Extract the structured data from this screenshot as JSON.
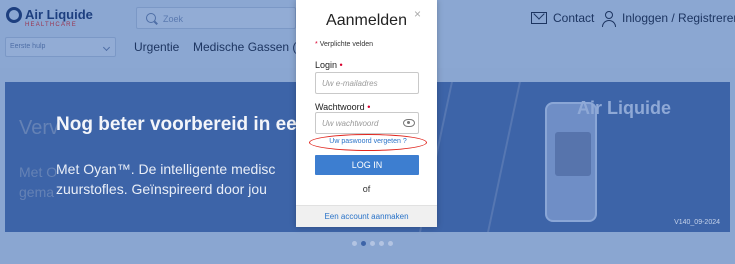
{
  "header": {
    "logo": {
      "name": "Air Liquide",
      "sub": "HEALTHCARE"
    },
    "search": {
      "placeholder": "Zoek"
    },
    "help_select": {
      "value": "Eerste hulp"
    },
    "nav": [
      "Urgentie",
      "Medische Gassen (ge"
    ],
    "contact_label": "Contact",
    "login_label": "Inloggen / Registreren"
  },
  "hero": {
    "ghost_title": "Verv",
    "ghost_text_1": "Met O",
    "ghost_text_2": "gema",
    "title": "Nog beter voorbereid in een",
    "text_line_1": "Met Oyan™. De intelligente medisc",
    "text_line_2": "zuurstofles. Geïnspireerd door jou",
    "brand": "Air Liquide",
    "version": "V140_09-2024"
  },
  "carousel": {
    "count": 5,
    "active": 2
  },
  "modal": {
    "title": "Aanmelden",
    "close_glyph": "×",
    "required_star": "*",
    "required_note": "Verplichte velden",
    "login_label": "Login",
    "login_placeholder": "Uw e-mailadres",
    "password_label": "Wachtwoord",
    "password_placeholder": "Uw wachtwoord",
    "forgot_link": "Uw paswoord vergeten ?",
    "login_button": "LOG IN",
    "or_text": "of",
    "create_account": "Een account aanmaken"
  },
  "colors": {
    "overlay_bg": "#8aa6d1",
    "hero_bg": "#3d64a8",
    "button_blue": "#3d7ed0",
    "link_blue": "#2a73c8",
    "required_red": "#d9002e",
    "highlight_red": "#e0261e"
  }
}
